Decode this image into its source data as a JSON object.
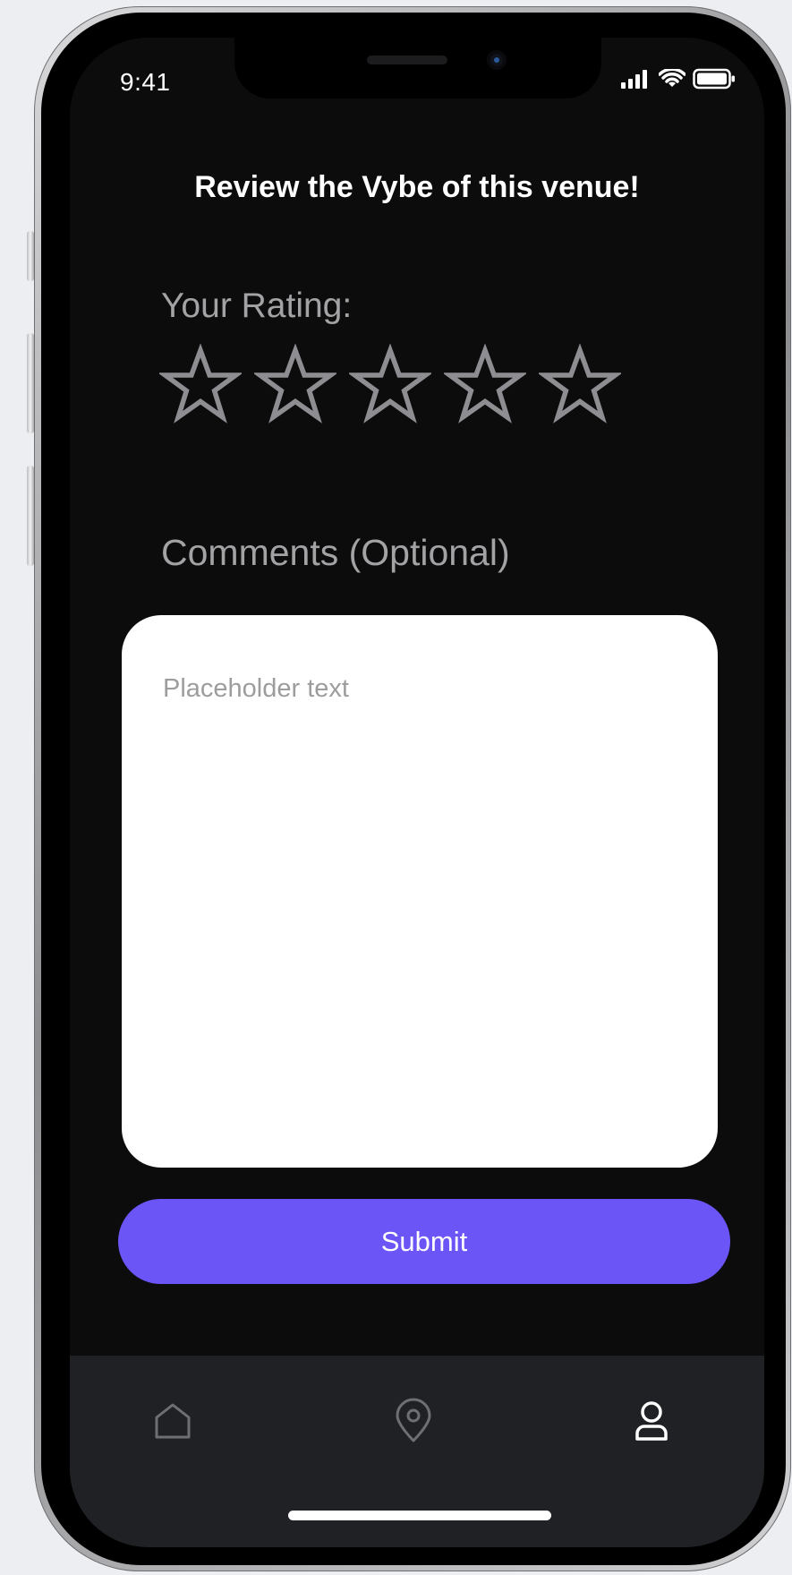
{
  "status_bar": {
    "time": "9:41",
    "icons": [
      "cellular-signal-icon",
      "wifi-icon",
      "battery-icon"
    ]
  },
  "page": {
    "title": "Review the Vybe of this venue!"
  },
  "rating": {
    "label": "Your Rating:",
    "selected": 0,
    "max": 5,
    "star_color": "#8e8e92"
  },
  "comments": {
    "label": "Comments (Optional)",
    "value": "",
    "placeholder": "Placeholder text"
  },
  "submit": {
    "label": "Submit",
    "color": "#6b55f6"
  },
  "tab_bar": {
    "items": [
      {
        "icon": "home-icon"
      },
      {
        "icon": "location-pin-icon"
      },
      {
        "icon": "profile-icon"
      }
    ]
  }
}
